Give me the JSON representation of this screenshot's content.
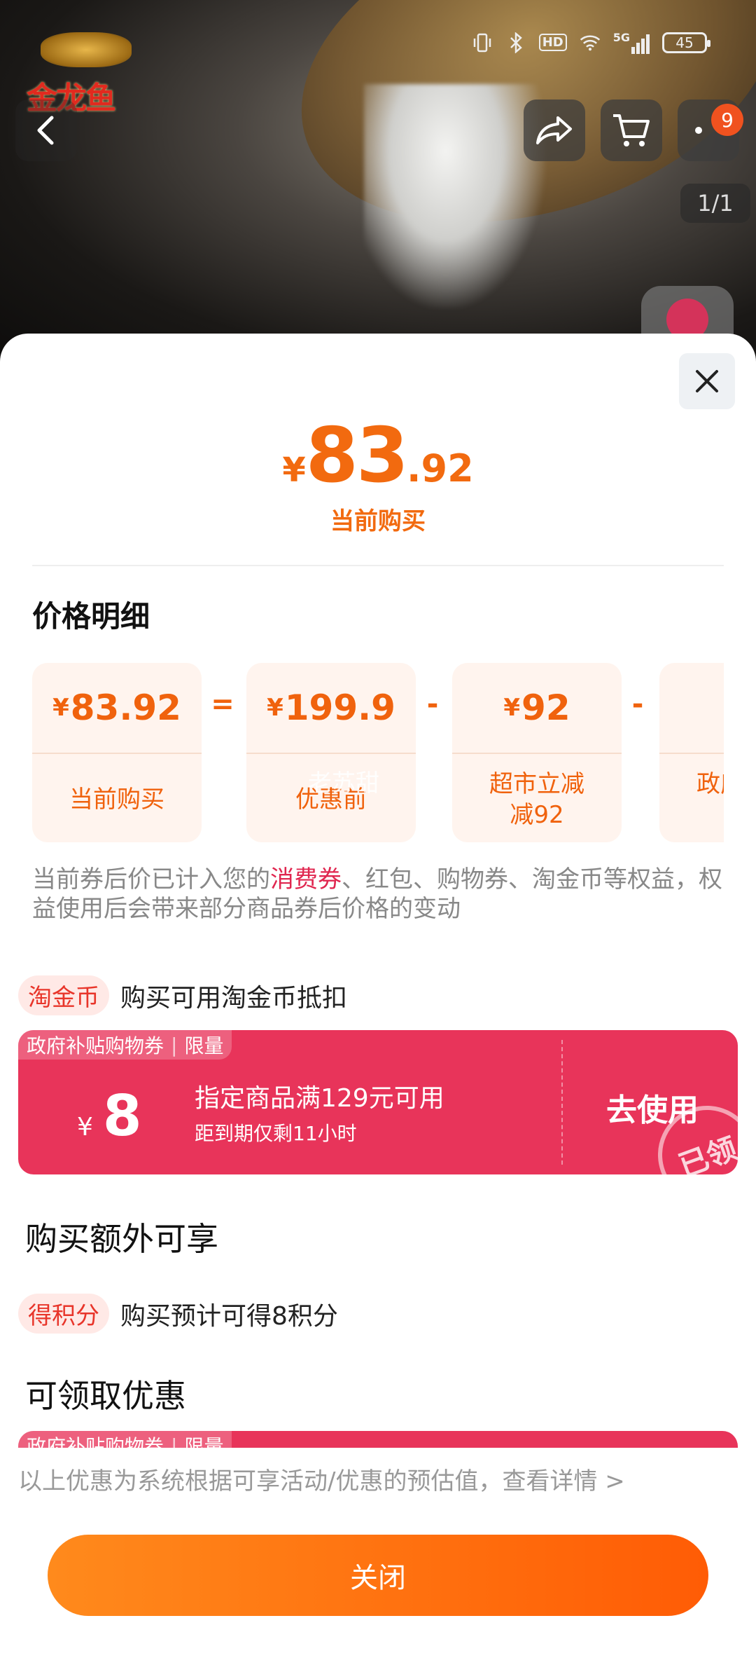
{
  "status_bar": {
    "battery": "45",
    "hd_label": "HD",
    "network_label": "5G"
  },
  "brand": {
    "logo_text": "金龙鱼"
  },
  "header": {
    "cart_badge": "9",
    "image_counter": "1/1"
  },
  "price": {
    "yen": "¥",
    "integer": "83",
    "decimal": ".92",
    "caption": "当前购买"
  },
  "details_title": "价格明细",
  "breakdown": [
    {
      "value": "83.92",
      "label": "当前购买"
    },
    {
      "op": "="
    },
    {
      "value": "199.9",
      "label": "优惠前"
    },
    {
      "op": "-"
    },
    {
      "value": "92",
      "label": "超市立减减92"
    },
    {
      "op": "-"
    },
    {
      "value": "",
      "label": "政府补贴满"
    }
  ],
  "watermark": "老苏甜",
  "note": {
    "before": "当前券后价已计入您的",
    "highlight": "消费券",
    "after": "、红包、购物券、淘金币等权益，权益使用后会带来部分商品券后价格的变动"
  },
  "taojinbi": {
    "tag": "淘金币",
    "text": "购买可用淘金币抵扣"
  },
  "coupon": {
    "tag": "政府补贴购物券",
    "limit": "限量",
    "yen": "¥",
    "amount": "8",
    "condition": "指定商品满129元可用",
    "expiry": "距到期仅剩11小时",
    "action": "去使用",
    "stamp": "已领"
  },
  "extra_title": "购买额外可享",
  "points": {
    "tag": "得积分",
    "text": "购买预计可得8积分"
  },
  "claim_title": "可领取优惠",
  "coupon2": {
    "tag": "政府补贴购物券",
    "limit": "限量"
  },
  "footer_note": "以上优惠为系统根据可享活动/优惠的预估值，查看详情 >",
  "close_button": "关闭",
  "colors": {
    "accent": "#f26a0f",
    "coupon": "#e8345a",
    "tag_red": "#e8352a"
  }
}
